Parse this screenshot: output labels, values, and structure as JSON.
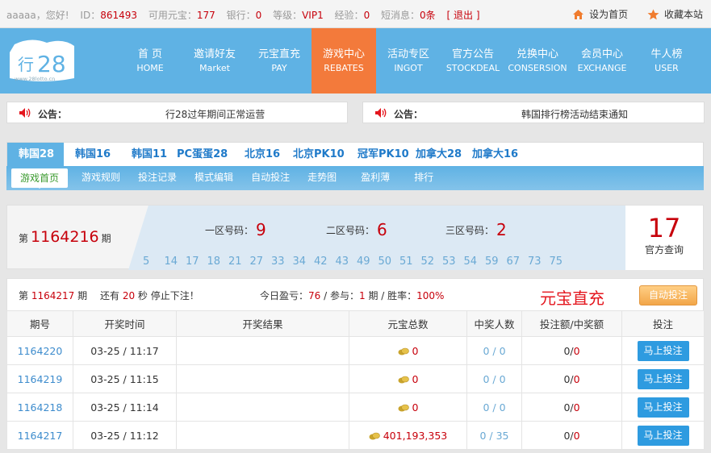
{
  "topbar": {
    "username": "aaaaa",
    "greeting": "，您好!",
    "id_label": "ID：",
    "id_value": "861493",
    "yuanbao_label": "可用元宝：",
    "yuanbao_value": "177",
    "bank_label": "银行：",
    "bank_value": "0",
    "level_label": "等级：",
    "level_value": "VIP1",
    "exp_label": "经验：",
    "exp_value": "0",
    "msg_label": "短消息：",
    "msg_value": "0条",
    "logout": "[ 退出 ]",
    "set_home": "设为首页",
    "bookmark": "收藏本站"
  },
  "logo": {
    "text": "行28",
    "url_text": "www.28lotto.cn"
  },
  "nav": [
    {
      "cn": "首  页",
      "en": "HOME"
    },
    {
      "cn": "邀请好友",
      "en": "Market"
    },
    {
      "cn": "元宝直充",
      "en": "PAY"
    },
    {
      "cn": "游戏中心",
      "en": "REBATES"
    },
    {
      "cn": "活动专区",
      "en": "INGOT"
    },
    {
      "cn": "官方公告",
      "en": "STOCKDEAL"
    },
    {
      "cn": "兑换中心",
      "en": "CONSERSION"
    },
    {
      "cn": "会员中心",
      "en": "EXCHANGE"
    },
    {
      "cn": "牛人榜",
      "en": "USER"
    }
  ],
  "notices": [
    {
      "label": "公告：",
      "text": "行28过年期间正常运营"
    },
    {
      "label": "公告：",
      "text": "韩国排行榜活动结束通知"
    }
  ],
  "game_tabs": [
    "韩国28",
    "韩国16",
    "韩国11",
    "PC蛋蛋28",
    "北京16",
    "北京PK10",
    "冠军PK10",
    "加拿大28",
    "加拿大16"
  ],
  "sub_tabs": [
    "游戏首页",
    "游戏规则",
    "投注记录",
    "模式编辑",
    "自动投注",
    "走势图",
    "盈利薄",
    "排行"
  ],
  "current": {
    "prefix": "第",
    "period": "1164216",
    "suffix": "期",
    "zone1_label": "一区号码：",
    "zone1": "9",
    "zone2_label": "二区号码：",
    "zone2": "6",
    "zone3_label": "三区号码：",
    "zone3": "2",
    "numbers": [
      "5",
      "14",
      "17",
      "18",
      "21",
      "27",
      "33",
      "34",
      "42",
      "43",
      "49",
      "50",
      "51",
      "52",
      "53",
      "54",
      "59",
      "67",
      "73",
      "75"
    ],
    "result": "17",
    "result_label": "官方查询"
  },
  "info": {
    "prefix": "第",
    "period": "1164217",
    "suffix": "期",
    "remain_pre": "还有",
    "remain": "20",
    "remain_suf": "秒 停止下注！",
    "today_label": "今日盈亏：",
    "today": "76",
    "join_label": " / 参与：",
    "join": "1",
    "join_suf": "期 / 胜率：",
    "rate": "100%",
    "promo": "元宝直充",
    "auto_bet": "自动投注"
  },
  "table": {
    "headers": [
      "期号",
      "开奖时间",
      "开奖结果",
      "元宝总数",
      "中奖人数",
      "投注额/中奖额",
      "投注"
    ],
    "rows": [
      {
        "period": "1164220",
        "time": "03-25 / 11:17",
        "result": "",
        "pool": "0",
        "winners": "0 / 0",
        "bet_a": "0",
        "bet_b": "0",
        "action": "马上投注"
      },
      {
        "period": "1164219",
        "time": "03-25 / 11:15",
        "result": "",
        "pool": "0",
        "winners": "0 / 0",
        "bet_a": "0",
        "bet_b": "0",
        "action": "马上投注"
      },
      {
        "period": "1164218",
        "time": "03-25 / 11:14",
        "result": "",
        "pool": "0",
        "winners": "0 / 0",
        "bet_a": "0",
        "bet_b": "0",
        "action": "马上投注"
      },
      {
        "period": "1164217",
        "time": "03-25 / 11:12",
        "result": "",
        "pool": "401,193,353",
        "winners": "0 / 35",
        "bet_a": "0",
        "bet_b": "0",
        "action": "马上投注"
      }
    ]
  },
  "colors": {
    "header": "#5fb2e4",
    "active_nav": "#f37a3b",
    "accent_red": "#c7000b",
    "bet_button": "#2e9be0"
  }
}
